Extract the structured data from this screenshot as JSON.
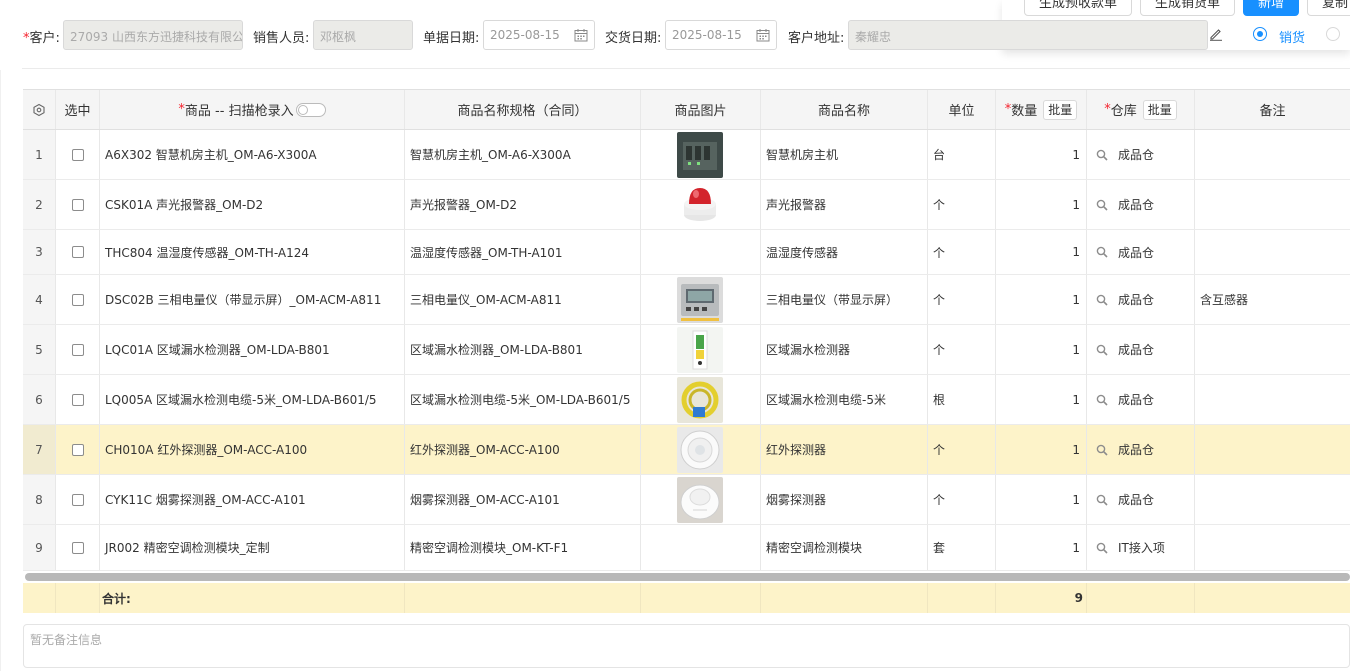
{
  "toolbar": {
    "btn_receipt": "生成预收款单",
    "btn_sales_order": "生成销货单",
    "btn_new": "新增",
    "btn_copy": "复制"
  },
  "form": {
    "customer_label": "客户:",
    "customer_value": "27093 山西东方迅捷科技有限公司",
    "salesperson_label": "销售人员:",
    "salesperson_value": "邓枢枫",
    "doc_date_label": "单据日期:",
    "doc_date_value": "2025-08-15",
    "delivery_date_label": "交货日期:",
    "delivery_date_value": "2025-08-15",
    "address_label": "客户地址:",
    "address_value": "秦耀忠",
    "radio_sales_label": "销货",
    "radio_sales_selected": true
  },
  "table": {
    "headers": {
      "select": "选中",
      "product": "商品 -- 扫描枪录入",
      "spec": "商品名称规格（合同）",
      "image": "商品图片",
      "name": "商品名称",
      "unit": "单位",
      "qty": "数量",
      "qty_batch": "批量",
      "warehouse": "仓库",
      "warehouse_batch": "批量",
      "remark": "备注"
    },
    "rows": [
      {
        "no": "1",
        "product": "A6X302 智慧机房主机_OM-A6-X300A",
        "spec": "智慧机房主机_OM-A6-X300A",
        "image": "host-device",
        "name": "智慧机房主机",
        "unit": "台",
        "qty": "1",
        "warehouse": "成品仓",
        "remark": ""
      },
      {
        "no": "2",
        "product": "CSK01A 声光报警器_OM-D2",
        "spec": "声光报警器_OM-D2",
        "image": "alarm-device",
        "name": "声光报警器",
        "unit": "个",
        "qty": "1",
        "warehouse": "成品仓",
        "remark": ""
      },
      {
        "no": "3",
        "product": "THC804 温湿度传感器_OM-TH-A124",
        "spec": "温湿度传感器_OM-TH-A101",
        "image": "",
        "name": "温湿度传感器",
        "unit": "个",
        "qty": "1",
        "warehouse": "成品仓",
        "remark": ""
      },
      {
        "no": "4",
        "product": "DSC02B 三相电量仪（带显示屏）_OM-ACM-A811",
        "spec": "三相电量仪_OM-ACM-A811",
        "image": "meter-device",
        "name": "三相电量仪（带显示屏）",
        "unit": "个",
        "qty": "1",
        "warehouse": "成品仓",
        "remark": "含互感器"
      },
      {
        "no": "5",
        "product": "LQC01A 区域漏水检测器_OM-LDA-B801",
        "spec": "区域漏水检测器_OM-LDA-B801",
        "image": "leak-detector",
        "name": "区域漏水检测器",
        "unit": "个",
        "qty": "1",
        "warehouse": "成品仓",
        "remark": ""
      },
      {
        "no": "6",
        "product": "LQ005A 区域漏水检测电缆-5米_OM-LDA-B601/5",
        "spec": "区域漏水检测电缆-5米_OM-LDA-B601/5",
        "image": "leak-cable",
        "name": "区域漏水检测电缆-5米",
        "unit": "根",
        "qty": "1",
        "warehouse": "成品仓",
        "remark": ""
      },
      {
        "no": "7",
        "product": "CH010A 红外探测器_OM-ACC-A100",
        "spec": "红外探测器_OM-ACC-A100",
        "image": "ir-detector",
        "name": "红外探测器",
        "unit": "个",
        "qty": "1",
        "warehouse": "成品仓",
        "remark": ""
      },
      {
        "no": "8",
        "product": "CYK11C 烟雾探测器_OM-ACC-A101",
        "spec": "烟雾探测器_OM-ACC-A101",
        "image": "smoke-detector",
        "name": "烟雾探测器",
        "unit": "个",
        "qty": "1",
        "warehouse": "成品仓",
        "remark": ""
      },
      {
        "no": "9",
        "product": "JR002 精密空调检测模块_定制",
        "spec": "精密空调检测模块_OM-KT-F1",
        "image": "",
        "name": "精密空调检测模块",
        "unit": "套",
        "qty": "1",
        "warehouse": "IT接入项",
        "remark": ""
      }
    ],
    "highlighted_row": 7,
    "total_label": "合计:",
    "total_qty": "9"
  },
  "remark_placeholder": "暂无备注信息",
  "colors": {
    "primary": "#1890ff",
    "required": "#f5222d",
    "highlight": "#fdf3c9"
  }
}
